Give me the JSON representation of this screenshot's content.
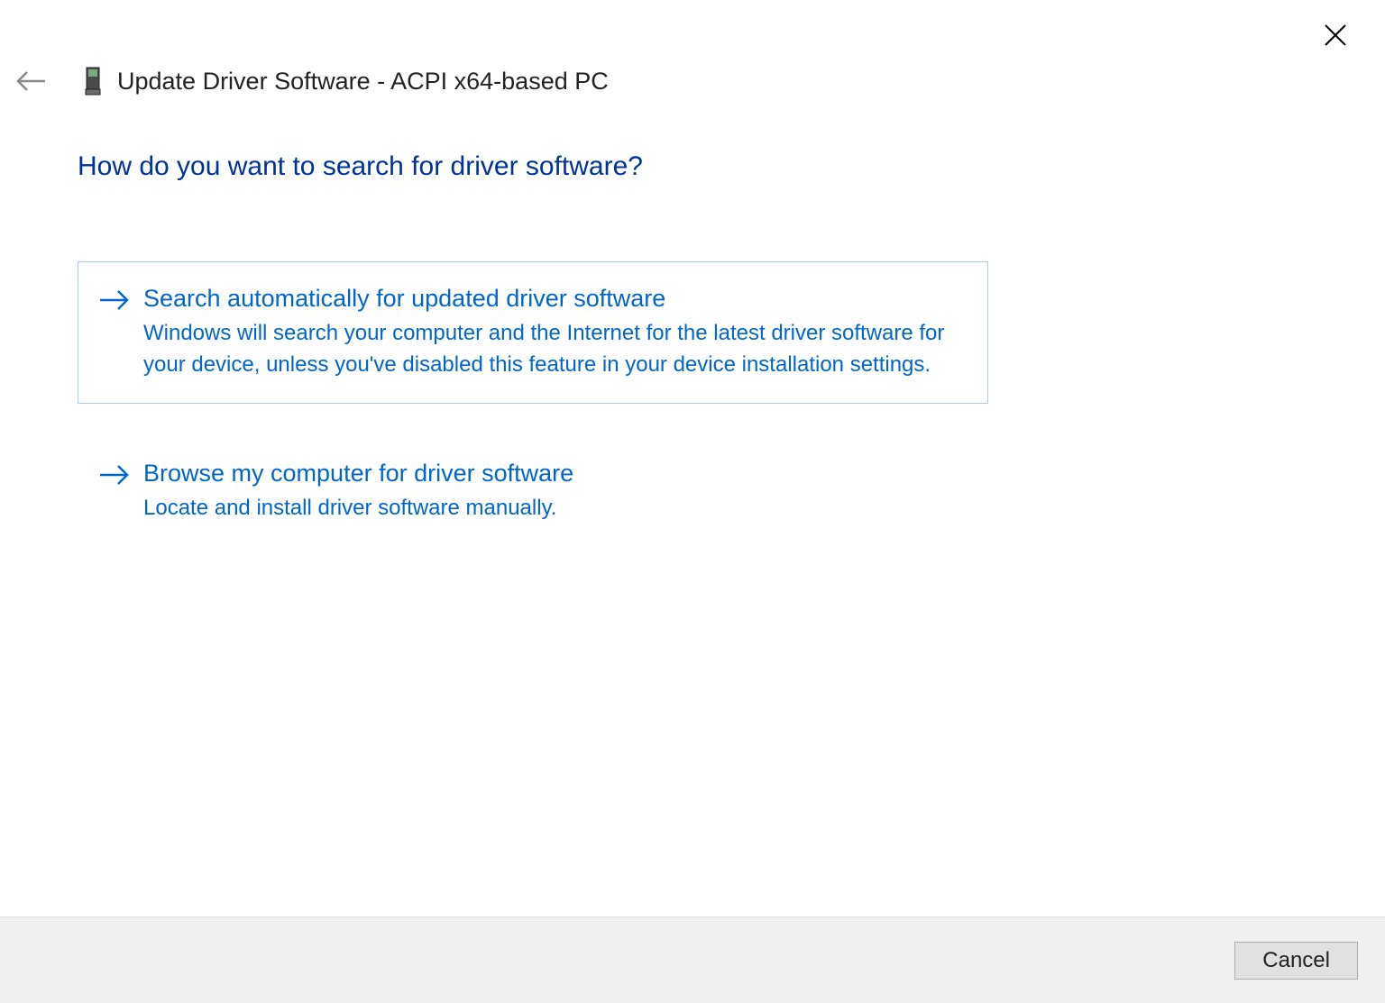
{
  "window": {
    "title": "Update Driver Software - ACPI x64-based PC"
  },
  "heading": "How do you want to search for driver software?",
  "options": [
    {
      "title": "Search automatically for updated driver software",
      "description": "Windows will search your computer and the Internet for the latest driver software for your device, unless you've disabled this feature in your device installation settings."
    },
    {
      "title": "Browse my computer for driver software",
      "description": "Locate and install driver software manually."
    }
  ],
  "footer": {
    "cancel_label": "Cancel"
  },
  "colors": {
    "heading": "#003399",
    "link": "#0066cc",
    "selection_border": "#a6cdf2",
    "footer_bg": "#f0f0f0"
  }
}
